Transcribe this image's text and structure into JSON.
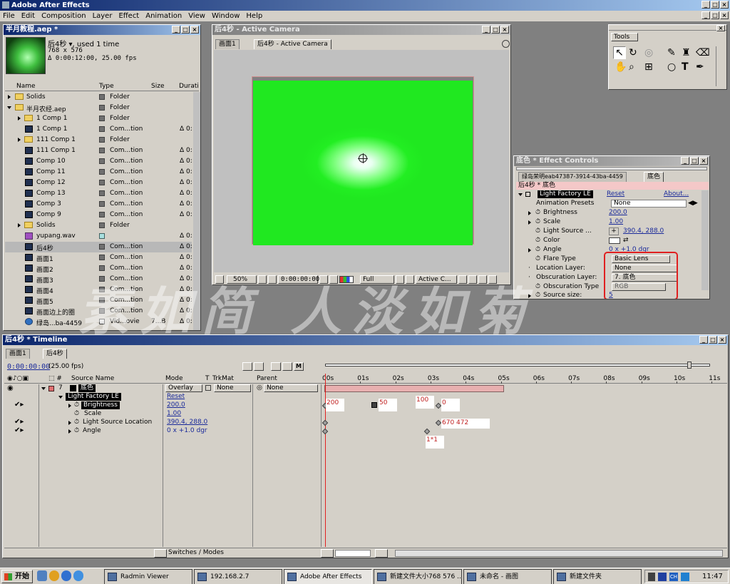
{
  "app": {
    "title": "Adobe After Effects"
  },
  "menu": [
    "File",
    "Edit",
    "Composition",
    "Layer",
    "Effect",
    "Animation",
    "View",
    "Window",
    "Help"
  ],
  "project": {
    "title": "半月教程.aep *",
    "info_name": "后4秒 ▾, used 1 time",
    "info_size": "768 x 576",
    "info_dur": "Δ 0:00:12:00, 25.00 fps",
    "col_name": "Name",
    "col_type": "Type",
    "col_size": "Size",
    "col_dur": "Durati",
    "rows": [
      {
        "name": "Solids",
        "type": "Folder",
        "dur": ""
      },
      {
        "name": "半月农经.aep",
        "type": "Folder",
        "dur": ""
      },
      {
        "name": "1 Comp 1",
        "type": "Folder",
        "dur": ""
      },
      {
        "name": "1 Comp 1",
        "type": "Com...tion",
        "dur": "Δ 0:"
      },
      {
        "name": "111 Comp 1",
        "type": "Folder",
        "dur": ""
      },
      {
        "name": "111 Comp 1",
        "type": "Com...tion",
        "dur": "Δ 0:"
      },
      {
        "name": "Comp 10",
        "type": "Com...tion",
        "dur": "Δ 0:"
      },
      {
        "name": "Comp 11",
        "type": "Com...tion",
        "dur": "Δ 0:"
      },
      {
        "name": "Comp 12",
        "type": "Com...tion",
        "dur": "Δ 0:"
      },
      {
        "name": "Comp 13",
        "type": "Com...tion",
        "dur": "Δ 0:"
      },
      {
        "name": "Comp 3",
        "type": "Com...tion",
        "dur": "Δ 0:"
      },
      {
        "name": "Comp 9",
        "type": "Com...tion",
        "dur": "Δ 0:"
      },
      {
        "name": "Solids",
        "type": "Folder",
        "dur": ""
      },
      {
        "name": "yupang.wav",
        "type": "",
        "dur": "Δ 0:"
      },
      {
        "name": "后4秒",
        "type": "Com...tion",
        "dur": "Δ 0:"
      },
      {
        "name": "画面1",
        "type": "Com...tion",
        "dur": "Δ 0:"
      },
      {
        "name": "画面2",
        "type": "Com...tion",
        "dur": "Δ 0:"
      },
      {
        "name": "画面3",
        "type": "Com...tion",
        "dur": "Δ 0:"
      },
      {
        "name": "画面4",
        "type": "Com...tion",
        "dur": "Δ 0:"
      },
      {
        "name": "画面5",
        "type": "Com...tion",
        "dur": "Δ 0:"
      },
      {
        "name": "画面边上的圈",
        "type": "Com...tion",
        "dur": "Δ 0:"
      },
      {
        "name": "绿岛...ba-4459",
        "type": "Vid...ovie",
        "size": "7...B",
        "dur": "Δ 0:"
      }
    ]
  },
  "comp": {
    "title": "后4秒 - Active Camera",
    "tab1": "画面1",
    "tab2": "后4秒 - Active Camera",
    "zoom": "50%",
    "time": "0:00:00:00",
    "res": "Full",
    "view": "Active C..."
  },
  "tools": {
    "title": "Tools"
  },
  "effect_controls": {
    "title": "底色 * Effect Controls",
    "tab1": "绿岛荣明eab47387-3914-43ba-4459",
    "tab2": "底色",
    "header": "后4秒 * 底色",
    "effect_name": "Light Factory LE",
    "reset": "Reset",
    "about": "About...",
    "presets_label": "Animation Presets",
    "presets_value": "None",
    "props": [
      {
        "label": "Brightness",
        "value": "200.0"
      },
      {
        "label": "Scale",
        "value": "1.00"
      },
      {
        "label": "Light Source ...",
        "value": "390.4, 288.0"
      },
      {
        "label": "Color",
        "value": ""
      },
      {
        "label": "Angle",
        "value": "0 x +1.0 dgr"
      },
      {
        "label": "Flare Type",
        "value": "Basic Lens"
      },
      {
        "label": "Location Layer:",
        "value": "None"
      },
      {
        "label": "Obscuration Layer:",
        "value": "7. 底色"
      },
      {
        "label": "Obscuration Type",
        "value": "RGB"
      },
      {
        "label": "Source size:",
        "value": "5"
      }
    ]
  },
  "watermark": "素如简 人淡如菊",
  "timeline": {
    "title": "后4秒 * Timeline",
    "tab1": "画面1",
    "tab2": "后4秒",
    "current_time": "0:00:00:00",
    "fps": "(25.00 fps)",
    "col_source": "Source Name",
    "col_mode": "Mode",
    "col_t": "T",
    "col_trkmat": "TrkMat",
    "col_parent": "Parent",
    "layer_num": "7",
    "layer_name": "底色",
    "layer_mode": "Overlay",
    "layer_trkmat": "None",
    "layer_parent": "None",
    "effect_name": "Light Factory LE",
    "effect_reset": "Reset",
    "props": [
      {
        "label": "Brightness",
        "value": "200.0"
      },
      {
        "label": "Scale",
        "value": "1.00"
      },
      {
        "label": "Light Source Location",
        "value": "390.4, 288.0"
      },
      {
        "label": "Angle",
        "value": "0 x +1.0 dgr"
      }
    ],
    "ticks": [
      "00s",
      "01s",
      "02s",
      "03s",
      "04s",
      "05s",
      "06s",
      "07s",
      "08s",
      "09s",
      "10s",
      "11s"
    ],
    "notes": [
      "200",
      "50",
      "100",
      "0",
      "670 472",
      "1*1"
    ],
    "switches": "Switches / Modes"
  },
  "taskbar": {
    "start": "开始",
    "items": [
      "Radmin Viewer",
      "192.168.2.7",
      "Adobe After Effects",
      "新建文件大小768 576 ...",
      "未命名 - 画图",
      "新建文件夹"
    ],
    "clock": "11:47"
  }
}
